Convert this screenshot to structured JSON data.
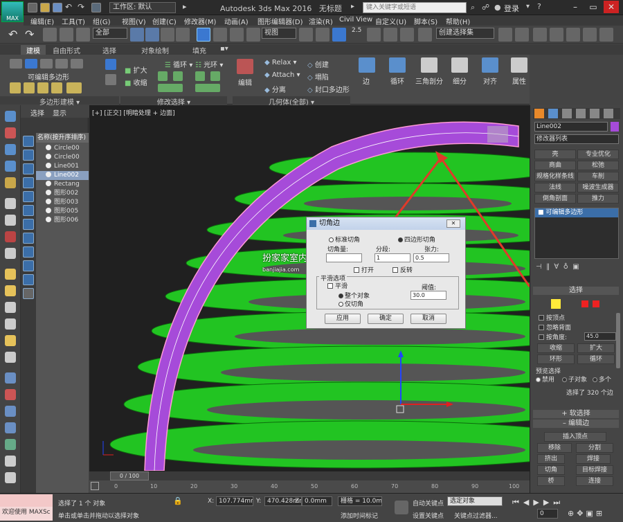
{
  "titlebar": {
    "logo_text": "MAX",
    "workspace": "工作区: 默认",
    "app_title": "Autodesk 3ds Max 2016",
    "doc_title": "无标题",
    "search_placeholder": "键入关键字或短语",
    "login": "登录"
  },
  "menubar": [
    "编辑(E)",
    "工具(T)",
    "组(G)",
    "视图(V)",
    "创建(C)",
    "修改器(M)",
    "动画(A)",
    "图形编辑器(D)",
    "渲染(R)",
    "Civil View",
    "自定义(U)",
    "脚本(S)",
    "帮助(H)"
  ],
  "toolbar": {
    "selection_filter": "全部",
    "ref_coord": "视图",
    "snap_value": "2.5",
    "named_selection": "创建选择集"
  },
  "ribbon": {
    "tabs": [
      "建模",
      "自由形式",
      "选择",
      "对象绘制",
      "填充"
    ],
    "editable_poly_label": "可编辑多边形",
    "group_poly_modeling": "多边形建模",
    "group_modify_selection": "修改选择",
    "grow": "扩大",
    "shrink": "收缩",
    "loop": "循环",
    "ring": "光环",
    "edit": "编辑",
    "relax": "Relax",
    "attach": "Attach",
    "detach": "分离",
    "create": "创建",
    "collapse": "塌陷",
    "cap_poly": "封口多边形",
    "group_geometry": "几何体(全部)",
    "edge": "边",
    "loop2": "循环",
    "tri": "三角剖分",
    "subdivide": "细分",
    "align": "对齐",
    "props": "属性"
  },
  "scene": {
    "tabs": [
      "选择",
      "显示"
    ],
    "header": "名称(按升序排序)",
    "items": [
      "Circle00",
      "Circle00",
      "Line001",
      "Line002",
      "Rectang",
      "图形002",
      "图形003",
      "图形005",
      "图形006"
    ],
    "selected_index": 3
  },
  "viewport": {
    "label": "[+] [正交] [明暗处理 + 边面]"
  },
  "dialog": {
    "title": "切角边",
    "standard": "标准切角",
    "quad": "四边形切角",
    "amount_label": "切角量:",
    "segments_label": "分段:",
    "tension_label": "张力:",
    "amount": "",
    "segments": "1",
    "tension": "0.5",
    "open": "打开",
    "invert": "反转",
    "smooth_group": "平滑选项",
    "smooth": "平滑",
    "whole_object": "整个对象",
    "chamfers_only": "仅切角",
    "threshold_label": "阈值:",
    "threshold": "30.0",
    "apply": "应用",
    "ok": "确定",
    "cancel": "取消"
  },
  "watermark": {
    "text": "扮家家室内设计",
    "url": "banjiajia.com"
  },
  "panel": {
    "object_name": "Line002",
    "modifier_list": "修改器列表",
    "buttons": [
      "壳",
      "专业优化",
      "商曲",
      "松弛",
      "规格化样条线",
      "车削",
      "法线",
      "噪波生成器",
      "倒角剖面",
      "推力"
    ],
    "stack_item": "可编辑多边形",
    "rollout_select": "选择",
    "by_vertex": "按顶点",
    "ignore_back": "忽略背面",
    "by_angle": "按角度:",
    "angle": "45.0",
    "shrink": "收缩",
    "grow": "扩大",
    "ring": "环形",
    "loop": "循环",
    "preview": "预览选择",
    "disable": "禁用",
    "subobject": "子对象",
    "multi": "多个",
    "selected_info": "选择了 320 个边",
    "soft_sel": "软选择",
    "edit_edges": "编辑边",
    "insert_vertex": "插入顶点",
    "remove": "移除",
    "split": "分割",
    "extrude": "挤出",
    "weld": "焊接",
    "chamfer": "切角",
    "target_weld": "目标焊接",
    "bridge": "桥",
    "connect": "连接"
  },
  "timeline": {
    "frame": "0 / 100",
    "ticks": [
      "0",
      "10",
      "20",
      "30",
      "40",
      "50",
      "60",
      "70",
      "80",
      "90",
      "100"
    ]
  },
  "status": {
    "welcome": "欢迎使用 MAXSc",
    "selected": "选择了 1 个 对象",
    "hint": "单击或单击并拖动以选择对象",
    "x_label": "X:",
    "x": "107.774mm",
    "y_label": "Y:",
    "y": "470.428mm",
    "z_label": "Z:",
    "z": "0.0mm",
    "grid": "栅格 = 10.0mm",
    "add_tag": "添加时间标记",
    "auto_key": "自动关键点",
    "selected_obj": "选定对象",
    "set_key": "设置关键点",
    "key_filter": "关键点过滤器..."
  },
  "colors": {
    "green": "#22c422",
    "purple": "#a64bd9",
    "arrow": "#e03a2a"
  }
}
